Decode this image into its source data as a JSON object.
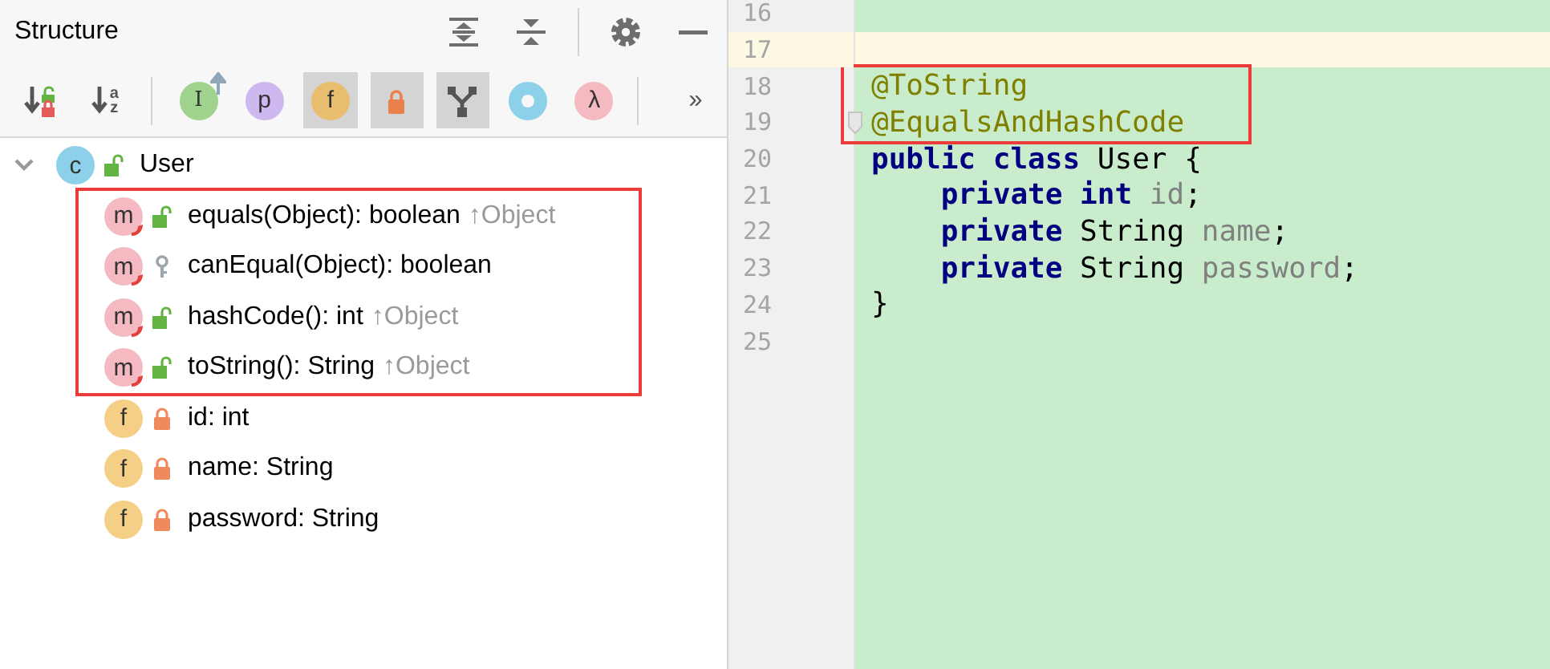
{
  "structure": {
    "title": "Structure",
    "header_actions": [
      [
        {
          "kind": "expand-all"
        },
        {
          "kind": "collapse-all"
        }
      ],
      [
        {
          "kind": "settings"
        },
        {
          "kind": "minimize"
        }
      ]
    ],
    "toolbar": [
      [
        {
          "kind": "sort-visibility",
          "selected": false
        },
        {
          "kind": "sort-alpha",
          "glyphs": [
            "a",
            "z"
          ],
          "selected": false
        }
      ],
      [
        {
          "kind": "inherited",
          "glyph": "I",
          "selected": false
        },
        {
          "kind": "properties",
          "glyph": "p",
          "selected": false
        },
        {
          "kind": "fields",
          "glyph": "f",
          "selected": true
        },
        {
          "kind": "non-public",
          "selected": true
        },
        {
          "kind": "hierarchy",
          "selected": true
        },
        {
          "kind": "anonymous",
          "selected": false
        },
        {
          "kind": "lambda",
          "glyph": "λ",
          "selected": false
        }
      ],
      [
        {
          "kind": "more",
          "glyph": "››"
        }
      ]
    ],
    "tree": [
      {
        "kind": "class",
        "glyph": "c",
        "access": {
          "kind": "public"
        },
        "label": "User",
        "expanded": true,
        "marked": false,
        "children": [
          {
            "kind": "method",
            "glyph": "m",
            "access": {
              "kind": "public"
            },
            "label": "equals(Object): boolean",
            "inherited": "↑Object",
            "marked": true
          },
          {
            "kind": "method",
            "glyph": "m",
            "access": {
              "kind": "package"
            },
            "label": "canEqual(Object): boolean",
            "marked": true
          },
          {
            "kind": "method",
            "glyph": "m",
            "access": {
              "kind": "public"
            },
            "label": "hashCode(): int",
            "inherited": "↑Object",
            "marked": true
          },
          {
            "kind": "method",
            "glyph": "m",
            "access": {
              "kind": "public"
            },
            "label": "toString(): String",
            "inherited": "↑Object",
            "marked": true
          },
          {
            "kind": "field",
            "glyph": "f",
            "access": {
              "kind": "private"
            },
            "label": "id: int",
            "marked": false
          },
          {
            "kind": "field",
            "glyph": "f",
            "access": {
              "kind": "private"
            },
            "label": "name: String",
            "marked": false
          },
          {
            "kind": "field",
            "glyph": "f",
            "access": {
              "kind": "private"
            },
            "label": "password: String",
            "marked": false
          }
        ]
      }
    ]
  },
  "editor": {
    "lines": [
      {
        "number": "16",
        "current": false,
        "marked": false,
        "fold": false
      },
      {
        "number": "17",
        "current": true,
        "marked": false,
        "fold": false
      },
      {
        "number": "18",
        "current": false,
        "marked": true,
        "fold": false,
        "tokens": [
          {
            "text": "@ToString",
            "kind": "annotation"
          }
        ]
      },
      {
        "number": "19",
        "current": false,
        "marked": true,
        "fold": true,
        "tokens": [
          {
            "text": "@EqualsAndHashCode",
            "kind": "annotation"
          }
        ]
      },
      {
        "number": "20",
        "current": false,
        "marked": false,
        "fold": false,
        "tokens": [
          {
            "text": "public",
            "kind": "keyword"
          },
          {
            "text": " class",
            "kind": "keyword"
          },
          {
            "text": " User {",
            "kind": "plain"
          }
        ]
      },
      {
        "number": "21",
        "current": false,
        "marked": false,
        "fold": false,
        "tokens": [
          {
            "text": "    private",
            "kind": "keyword"
          },
          {
            "text": " int",
            "kind": "keyword"
          },
          {
            "text": " id",
            "kind": "field"
          },
          {
            "text": ";",
            "kind": "plain"
          }
        ]
      },
      {
        "number": "22",
        "current": false,
        "marked": false,
        "fold": false,
        "tokens": [
          {
            "text": "    private",
            "kind": "keyword"
          },
          {
            "text": " String ",
            "kind": "plain"
          },
          {
            "text": "name",
            "kind": "field"
          },
          {
            "text": ";",
            "kind": "plain"
          }
        ]
      },
      {
        "number": "23",
        "current": false,
        "marked": false,
        "fold": false,
        "tokens": [
          {
            "text": "    private",
            "kind": "keyword"
          },
          {
            "text": " String ",
            "kind": "plain"
          },
          {
            "text": "password",
            "kind": "field"
          },
          {
            "text": ";",
            "kind": "plain"
          }
        ]
      },
      {
        "number": "24",
        "current": false,
        "marked": false,
        "fold": false,
        "tokens": [
          {
            "text": "}",
            "kind": "plain"
          }
        ]
      },
      {
        "number": "25",
        "current": false,
        "marked": false,
        "fold": false
      }
    ]
  }
}
